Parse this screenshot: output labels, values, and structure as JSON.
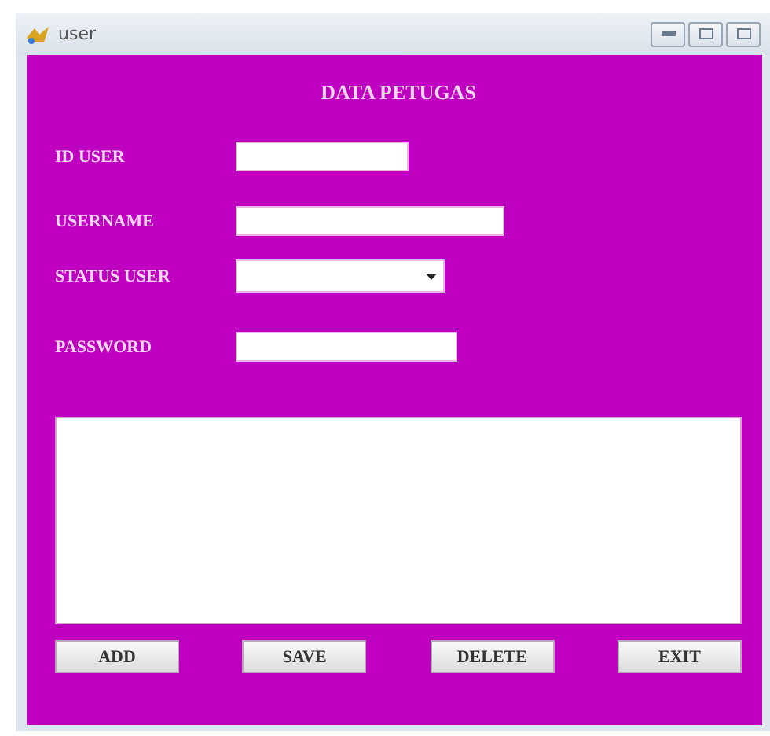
{
  "window": {
    "title": "user"
  },
  "heading": "DATA PETUGAS",
  "fields": [
    {
      "label": "ID USER",
      "kind": "text"
    },
    {
      "label": "USERNAME",
      "kind": "text"
    },
    {
      "label": "STATUS USER",
      "kind": "combo"
    },
    {
      "label": "PASSWORD",
      "kind": "password"
    }
  ],
  "buttons": [
    "ADD",
    "SAVE",
    "DELETE",
    "EXIT"
  ]
}
